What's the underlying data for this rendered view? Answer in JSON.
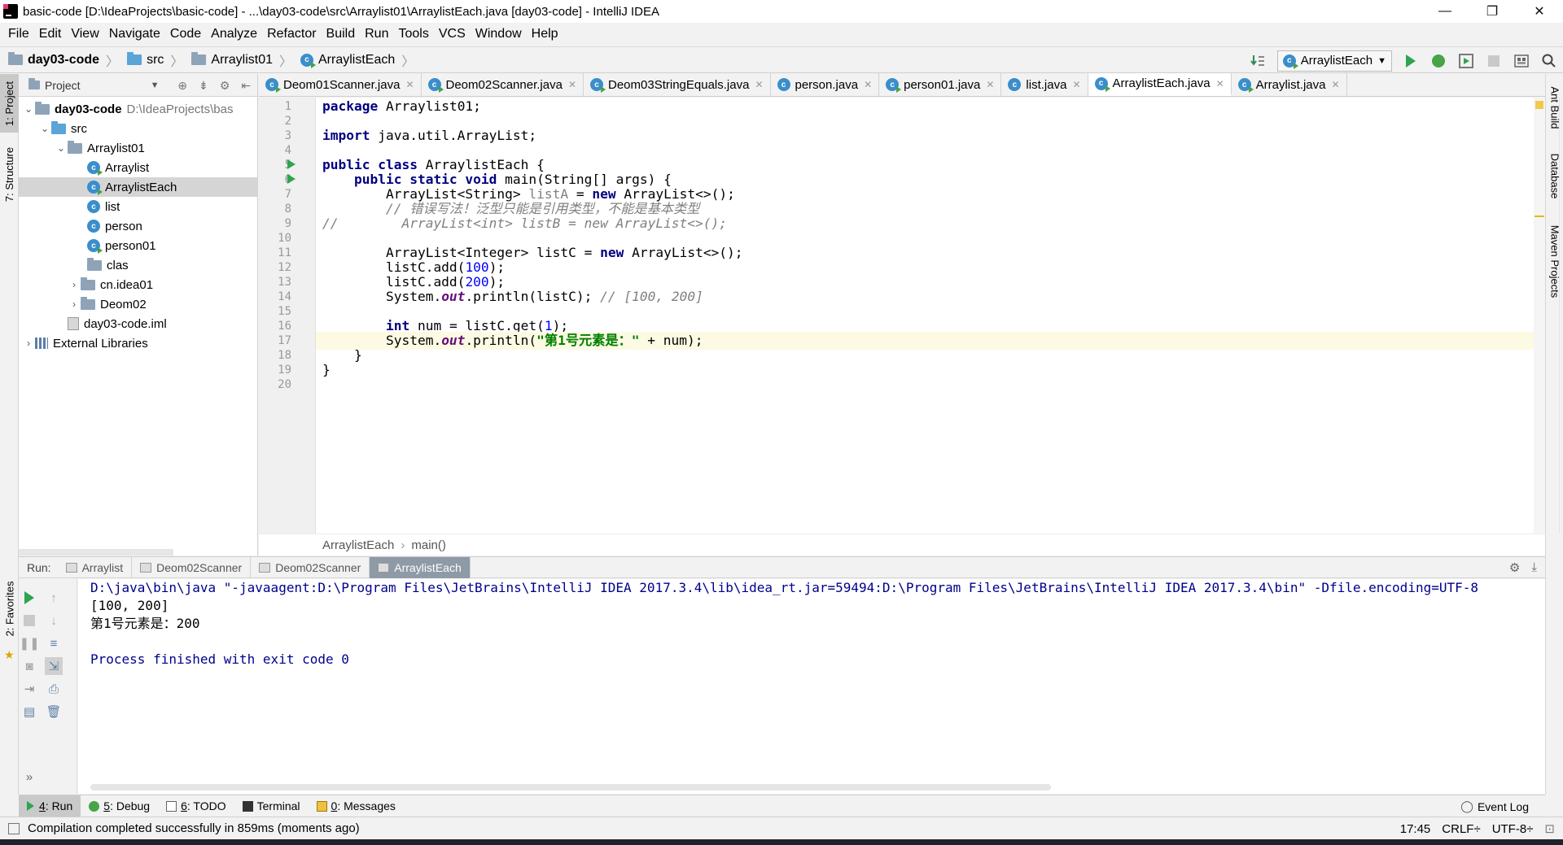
{
  "window": {
    "title": "basic-code [D:\\IdeaProjects\\basic-code] - ...\\day03-code\\src\\Arraylist01\\ArraylistEach.java [day03-code] - IntelliJ IDEA",
    "minimize": "—",
    "maximize": "❐",
    "close": "✕"
  },
  "menu": {
    "file": "File",
    "edit": "Edit",
    "view": "View",
    "navigate": "Navigate",
    "code": "Code",
    "analyze": "Analyze",
    "refactor": "Refactor",
    "build": "Build",
    "run": "Run",
    "tools": "Tools",
    "vcs": "VCS",
    "window": "Window",
    "help": "Help"
  },
  "nav": {
    "module": "day03-code",
    "src": "src",
    "package": "Arraylist01",
    "file": "ArraylistEach",
    "run_config": "ArraylistEach"
  },
  "left_strip": {
    "project": "1: Project",
    "structure": "7: Structure",
    "favorites": "2: Favorites"
  },
  "right_strip": {
    "ant": "Ant Build",
    "database": "Database",
    "maven": "Maven Projects"
  },
  "project_panel": {
    "title": "Project",
    "tree": [
      {
        "label": "day03-code",
        "extra": "D:\\IdeaProjects\\bas"
      },
      {
        "label": "src"
      },
      {
        "label": "Arraylist01"
      },
      {
        "label": "Arraylist"
      },
      {
        "label": "ArraylistEach"
      },
      {
        "label": "list"
      },
      {
        "label": "person"
      },
      {
        "label": "person01"
      },
      {
        "label": "clas"
      },
      {
        "label": "cn.idea01"
      },
      {
        "label": "Deom02"
      },
      {
        "label": "day03-code.iml"
      },
      {
        "label": "External Libraries"
      }
    ]
  },
  "editor_tabs": [
    {
      "label": "Deom01Scanner.java"
    },
    {
      "label": "Deom02Scanner.java"
    },
    {
      "label": "Deom03StringEquals.java"
    },
    {
      "label": "person.java"
    },
    {
      "label": "person01.java"
    },
    {
      "label": "list.java"
    },
    {
      "label": "ArraylistEach.java"
    },
    {
      "label": "Arraylist.java"
    }
  ],
  "editor": {
    "line_numbers": [
      "1",
      "2",
      "3",
      "4",
      "5",
      "6",
      "7",
      "8",
      "9",
      "10",
      "11",
      "12",
      "13",
      "14",
      "15",
      "16",
      "17",
      "18",
      "19",
      "20"
    ],
    "current_line": 17,
    "breadcrumb_class": "ArraylistEach",
    "breadcrumb_method": "main()"
  },
  "run_panel": {
    "label": "Run:",
    "tabs": [
      {
        "label": "Arraylist"
      },
      {
        "label": "Deom02Scanner"
      },
      {
        "label": "Deom02Scanner"
      },
      {
        "label": "ArraylistEach"
      }
    ],
    "console": [
      "D:\\java\\bin\\java \"-javaagent:D:\\Program Files\\JetBrains\\IntelliJ IDEA 2017.3.4\\lib\\idea_rt.jar=59494:D:\\Program Files\\JetBrains\\IntelliJ IDEA 2017.3.4\\bin\" -Dfile.encoding=UTF-8",
      "[100, 200]",
      "第1号元素是：200",
      "",
      "Process finished with exit code 0"
    ]
  },
  "bottom_tools": {
    "run_num": "4",
    "run": ": Run",
    "debug_num": "5",
    "debug": ": Debug",
    "todo_num": "6",
    "todo": ": TODO",
    "terminal": "Terminal",
    "messages_num": "0",
    "messages": ": Messages",
    "event_log": "Event Log"
  },
  "status": {
    "message": "Compilation completed successfully in 859ms (moments ago)",
    "position": "17:45",
    "line_sep": "CRLF",
    "encoding": "UTF-8"
  },
  "colors": {
    "keyword": "#000080",
    "string": "#008000",
    "number": "#0000ff",
    "comment": "#808080",
    "current_line": "#fcfae3",
    "run_green": "#2ea44f"
  }
}
